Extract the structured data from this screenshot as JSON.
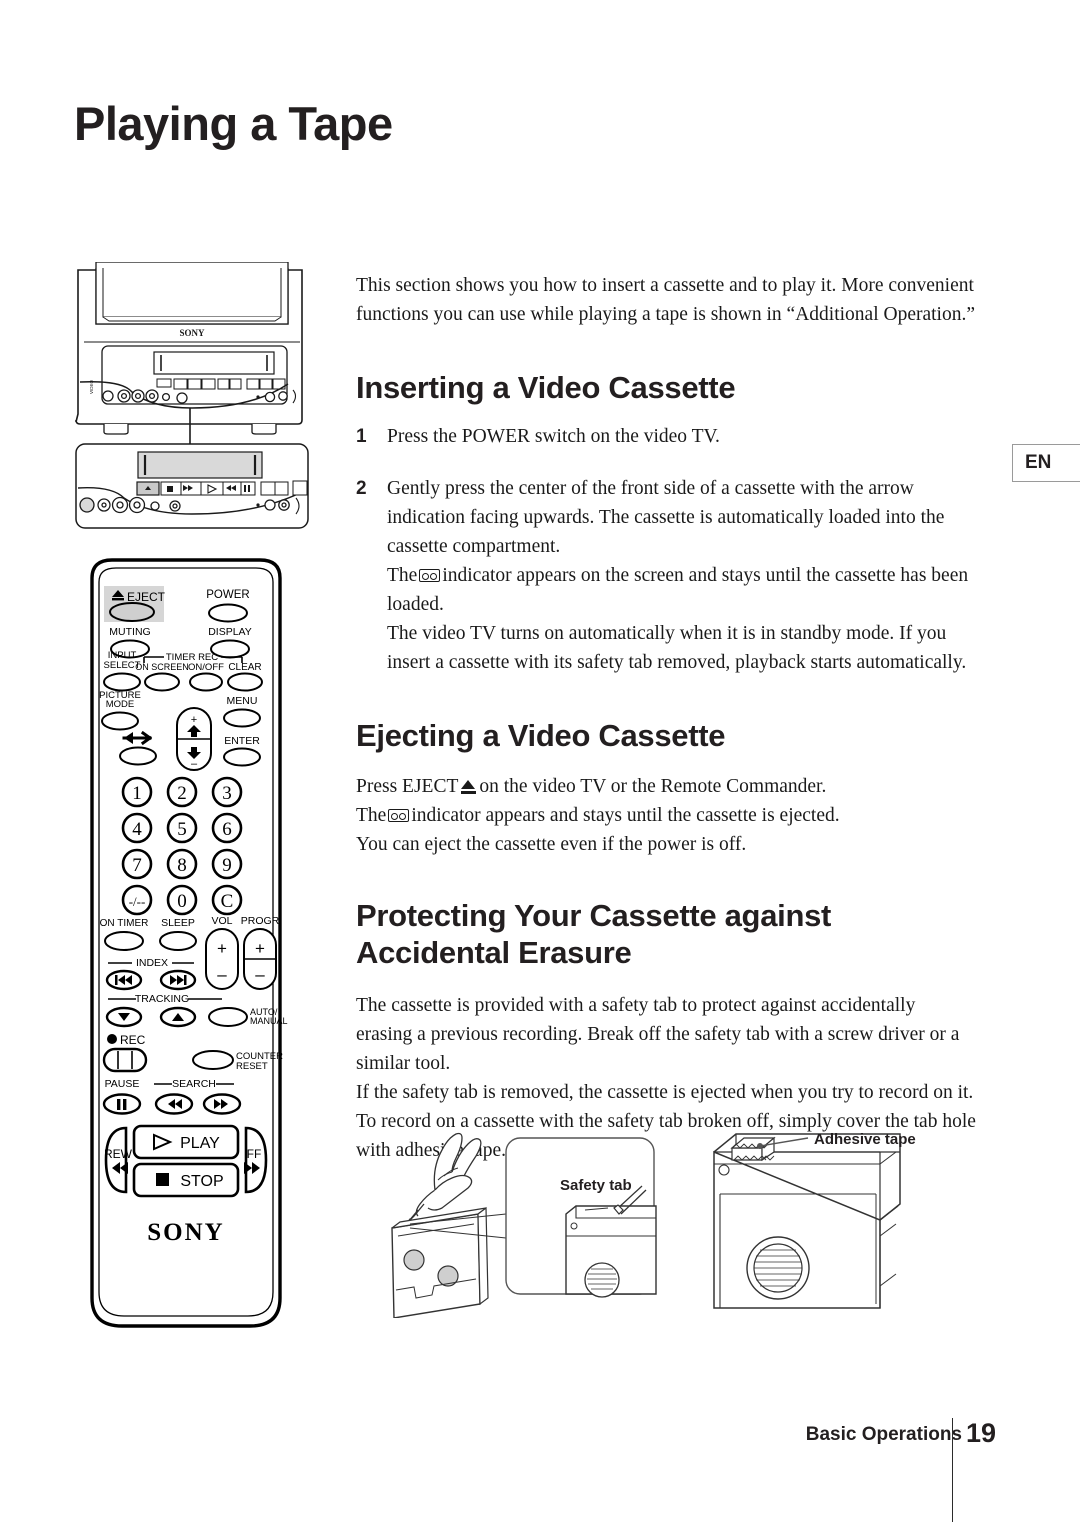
{
  "page": {
    "title": "Playing a Tape",
    "language_tab": "EN",
    "footer_chapter": "Basic Operations",
    "footer_page_number": "19"
  },
  "intro": {
    "text": "This section shows you how to insert a cassette and to play it.  More convenient functions you can use while playing a tape is shown in “Additional Operation.”"
  },
  "sections": {
    "inserting": {
      "heading": "Inserting a Video Cassette",
      "step1_num": "1",
      "step1_text": "Press the POWER switch on the video TV.",
      "step2_num": "2",
      "step2_a": "Gently press the center of the front side of a cassette with the arrow indication facing upwards.  The cassette is automatically loaded into the cassette compartment.",
      "step2_b_pre": "The",
      "step2_b_post": "indicator appears on the screen and stays until the cassette has been loaded.",
      "step2_c": "The video TV turns on automatically when it is in standby mode.  If you insert a cassette with its safety tab removed, playback starts automatically."
    },
    "ejecting": {
      "heading": "Ejecting a Video Cassette",
      "line1_pre": "Press EJECT",
      "line1_post": "on the video TV or the Remote Commander.",
      "line2_pre": "The",
      "line2_post": "indicator appears and stays until the cassette is ejected.",
      "line3": "You can eject the cassette even if the power is off."
    },
    "protecting": {
      "heading_line1": "Protecting Your Cassette against",
      "heading_line2": "Accidental Erasure",
      "p1": "The cassette is provided with a safety tab to protect against accidentally erasing a previous recording.  Break off the safety tab with a screw driver or a similar tool.",
      "p2": "If the safety tab is removed, the cassette is ejected when you try to record on it.",
      "p3": "To record on a cassette with the safety tab broken off, simply cover the tab hole with adhesive tape."
    }
  },
  "illustrations": {
    "tv": {
      "brand": "SONY"
    },
    "remote": {
      "brand": "SONY",
      "buttons": {
        "eject": "EJECT",
        "power": "POWER",
        "muting": "MUTING",
        "display": "DISPLAY",
        "input_select_line1": "INPUT",
        "input_select_line2": "SELECT",
        "on_screen": "ON SCREEN",
        "timer_rec": "TIMER REC",
        "on_off": "ON/OFF",
        "clear": "CLEAR",
        "picture_mode_line1": "PICTURE",
        "picture_mode_line2": "MODE",
        "menu": "MENU",
        "enter": "ENTER",
        "on_timer": "ON TIMER",
        "sleep": "SLEEP",
        "vol": "VOL",
        "progr": "PROGR",
        "index": "INDEX",
        "tracking": "TRACKING",
        "auto_manual_line1": "AUTO/",
        "auto_manual_line2": "MANUAL",
        "rec": "REC",
        "counter_reset_line1": "COUNTER",
        "counter_reset_line2": "RESET",
        "pause": "PAUSE",
        "search": "SEARCH",
        "play": "PLAY",
        "stop": "STOP",
        "rew": "REW",
        "ff": "FF",
        "plus": "+",
        "minus": "–"
      },
      "keypad": [
        "1",
        "2",
        "3",
        "4",
        "5",
        "6",
        "7",
        "8",
        "9",
        "-/--",
        "0",
        "C"
      ]
    },
    "safety_tab_callout": {
      "label": "Safety tab"
    },
    "adhesive_tape_callout": {
      "label": "Adhesive tape"
    }
  }
}
